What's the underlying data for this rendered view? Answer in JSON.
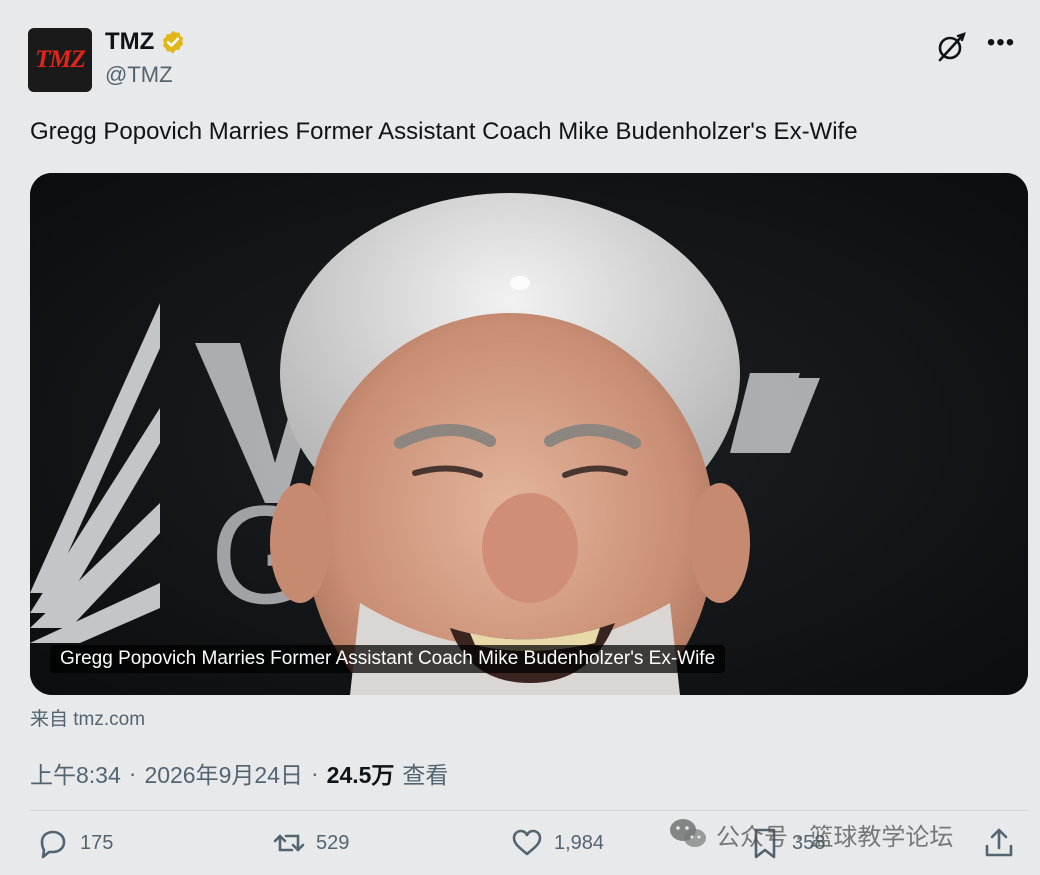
{
  "author": {
    "avatar_text": "TMZ",
    "display_name": "TMZ",
    "handle": "@TMZ"
  },
  "tweet": {
    "text": "Gregg Popovich Marries Former Assistant Coach Mike Budenholzer's Ex-Wife",
    "card_caption": "Gregg Popovich Marries Former Assistant Coach Mike Budenholzer's Ex-Wife",
    "source": "来自 tmz.com",
    "time": "上午8:34",
    "sep": "·",
    "date": "2026年9月24日",
    "views_count": "24.5万",
    "views_label": "查看"
  },
  "actions": {
    "replies": "175",
    "retweets": "529",
    "likes": "1,984",
    "bookmarks": "358"
  },
  "watermark": {
    "text": "公众号 · 篮球教学论坛"
  },
  "colors": {
    "background": "#e8e9ea",
    "text_secondary": "#536471",
    "verified_gold": "#e2b719",
    "brand_red": "#e2241b"
  }
}
